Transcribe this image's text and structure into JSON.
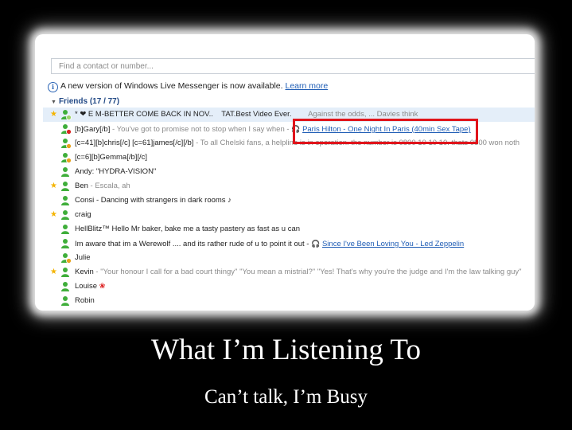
{
  "search": {
    "placeholder": "Find a contact or number..."
  },
  "notice": {
    "text": "A new version of Windows Live Messenger is now available.",
    "link": "Learn more"
  },
  "group": {
    "label": "Friends (17 / 77)"
  },
  "contacts": [
    {
      "name": "* ❤ E M-BETTER COME BACK IN NOV..",
      "status": "TAT.Best Video Ever.",
      "extra": "Against the odds, ... Davies think",
      "favorite": true,
      "presence": "online",
      "selected": true
    },
    {
      "name": "[b]Gary[/b]",
      "status": "- You've got to promise not to stop when I say when -",
      "music": "Paris Hilton - One Night In Paris (40min Sex Tape)",
      "favorite": false,
      "presence": "busy"
    },
    {
      "name": "[c=41][b]chris[/c] [c=61]james[/c][/b]",
      "status": "- To all Chelski fans, a helpline is in operation. the number is 0800 10 10 10. thats 0800 won noth",
      "favorite": false,
      "presence": "away"
    },
    {
      "name": "[c=6][b]Gemma[/b][/c]",
      "status": "",
      "favorite": false,
      "presence": "away"
    },
    {
      "name": "Andy: \"HYDRA-VISION\"",
      "status": "",
      "favorite": false,
      "presence": "online"
    },
    {
      "name": "Ben",
      "status": "- Escala, ah",
      "favorite": true,
      "presence": "online"
    },
    {
      "name": "Consi",
      "status": "- Dancing with strangers in dark rooms ♪",
      "favorite": false,
      "presence": "online"
    },
    {
      "name": "craig",
      "status": "",
      "favorite": true,
      "presence": "online"
    },
    {
      "name": "HellBlitz™ Hello Mr baker, bake me a tasty pastery as fast as u can",
      "status": "",
      "favorite": false,
      "presence": "online"
    },
    {
      "name": "Im aware that im a Werewolf .... and its rather rude of u to point it out",
      "status": "-",
      "music": "Since I've Been Loving You - Led Zeppelin",
      "favorite": false,
      "presence": "online"
    },
    {
      "name": "Julie",
      "status": "",
      "favorite": false,
      "presence": "away"
    },
    {
      "name": "Kevin",
      "status": "- \"Your honour I call for a bad court thingy\" \"You mean a mistrial?\" \"Yes! That's why you're the judge and I'm the law talking guy\"",
      "favorite": true,
      "presence": "online"
    },
    {
      "name": "Louise",
      "status": "❀",
      "favorite": false,
      "presence": "online"
    },
    {
      "name": "Robin",
      "status": "",
      "favorite": false,
      "presence": "online"
    }
  ],
  "caption": {
    "title": "What I’m Listening To",
    "subtitle": "Can’t talk, I’m Busy"
  },
  "colors": {
    "highlight": "#e0141b",
    "link": "#1f5db5",
    "favorite": "#f4b400",
    "online": "#3fae3a",
    "busy": "#d9231f",
    "away": "#e7a21b"
  },
  "icons": [
    "info-icon",
    "star-icon",
    "buddy-icon",
    "headphones-icon",
    "heart-icon"
  ]
}
